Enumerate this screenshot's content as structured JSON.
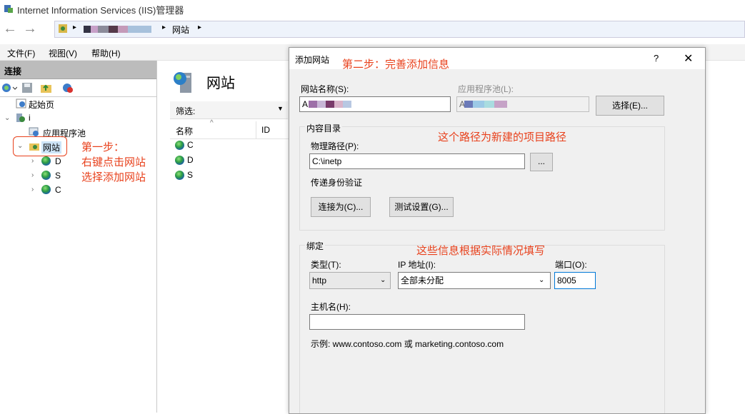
{
  "window": {
    "title": "Internet Information Services (IIS)管理器"
  },
  "navbar": {
    "back": "←",
    "forward": "→",
    "crumb_sep1": "▸",
    "crumb_sep2": "▸",
    "crumb_sep3": "▸",
    "crumb_sites": "网站"
  },
  "menu": {
    "file": "文件(F)",
    "view": "视图(V)",
    "help": "帮助(H)"
  },
  "connections": {
    "header": "连接",
    "tree": {
      "start_page": "起始页",
      "server": "i",
      "app_pools": "应用程序池",
      "sites": "网站",
      "site1": "D",
      "site2": "S",
      "site3": "C"
    }
  },
  "middle": {
    "title": "网站",
    "filter_label": "筛选:",
    "col_name": "名称",
    "col_id": "ID",
    "rows": [
      "C",
      "D",
      "S"
    ]
  },
  "annotations": {
    "step1_line1": "第一步：",
    "step1_line2": "右键点击网站",
    "step1_line3": "选择添加网站",
    "step2": "第二步：完善添加信息",
    "path_note": "这个路径为新建的项目路径",
    "binding_note": "这些信息根据实际情况填写"
  },
  "dialog": {
    "title": "添加网站",
    "help": "?",
    "close": "✕",
    "site_name_label": "网站名称(S):",
    "site_name_value": "A",
    "app_pool_label": "应用程序池(L):",
    "app_pool_value": "A",
    "select_button": "选择(E)...",
    "content_dir_group": "内容目录",
    "physical_path_label": "物理路径(P):",
    "physical_path_value": "C:\\inetp",
    "browse_button": "...",
    "pass_through_label": "传递身份验证",
    "connect_as_button": "连接为(C)...",
    "test_settings_button": "测试设置(G)...",
    "binding_group": "绑定",
    "type_label": "类型(T):",
    "type_value": "http",
    "ip_label": "IP 地址(I):",
    "ip_value": "全部未分配",
    "port_label": "端口(O):",
    "port_value": "8005",
    "hostname_label": "主机名(H):",
    "hostname_value": "",
    "example_text": "示例: www.contoso.com 或 marketing.contoso.com"
  },
  "colors": {
    "annotation": "#e8411c",
    "dialog_bg": "#f0f0f0",
    "header_gray": "#bcbcbc"
  }
}
